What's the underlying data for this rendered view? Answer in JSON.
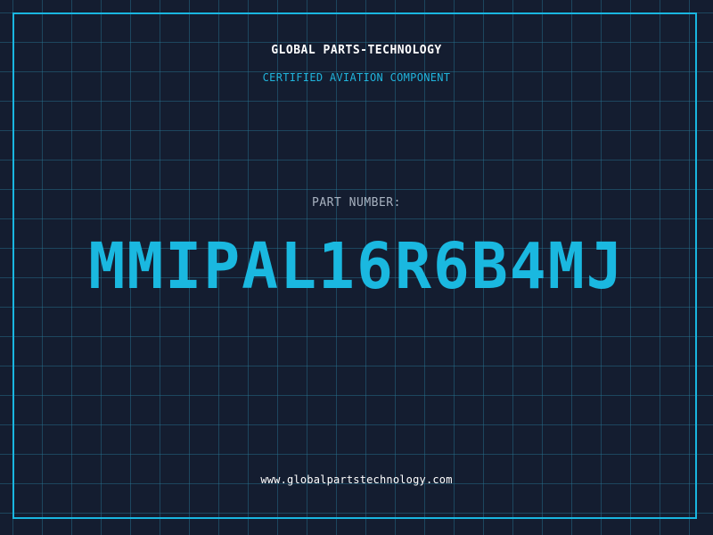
{
  "company": "GLOBAL PARTS-TECHNOLOGY",
  "tagline": "CERTIFIED AVIATION COMPONENT",
  "part_label": "PART NUMBER:",
  "part_number": "MMIPAL16R6B4MJ",
  "website": "www.globalpartstechnology.com",
  "colors": {
    "background": "#141d30",
    "accent": "#19b6e0",
    "grid": "#287896"
  }
}
